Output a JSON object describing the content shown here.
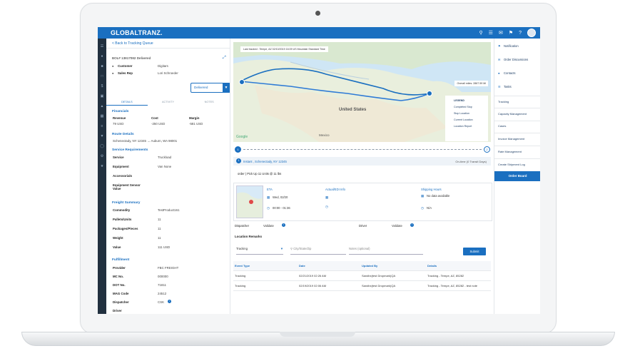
{
  "app": {
    "logo": "GLOBALTRANZ."
  },
  "detail": {
    "back_label": "< Back to Tracking Queue",
    "bol_status": "BOL# 13817082 Delivered",
    "customer_label": "Customer",
    "customer_value": "Digitars",
    "sales_rep_label": "Sales Rep",
    "sales_rep_value": "Lori Schroeder",
    "status_button": "Delivered",
    "tabs": [
      "DETAILS",
      "ACTIVITY",
      "NOTES"
    ],
    "financials_h": "Financials",
    "fin_headers": [
      "Revenue",
      "Cost",
      "Margin"
    ],
    "fin_values": [
      "79 USD",
      "-250 USD",
      "-581 USD"
    ],
    "route_h": "Route Details",
    "route_value": "Schenectady, NY 12345 → Auburn, WA 98001",
    "service_h": "Service Requirements",
    "service_rows": [
      {
        "k": "Service",
        "v": "Truckload"
      },
      {
        "k": "Equipment",
        "v": "Van None"
      },
      {
        "k": "Accessorials",
        "v": ""
      },
      {
        "k": "Equipment Sensor Value",
        "v": ""
      }
    ],
    "freight_h": "Freight Summary",
    "freight_rows": [
      {
        "k": "Commodity",
        "v": "TestProduct161"
      },
      {
        "k": "Pallets/Units",
        "v": "11"
      },
      {
        "k": "Packages/Pieces",
        "v": "11"
      },
      {
        "k": "Weight",
        "v": "11"
      },
      {
        "k": "Value",
        "v": "111 USD"
      }
    ],
    "fulfillment_h": "Fulfillment",
    "fulfillment_rows": [
      {
        "k": "Provider",
        "v": "FBC FREIGHT"
      },
      {
        "k": "MC No.",
        "v": "000000"
      },
      {
        "k": "DOT No.",
        "v": "71811"
      },
      {
        "k": "MAG Code",
        "v": "24512"
      },
      {
        "k": "Dispatcher",
        "v": "CSK"
      },
      {
        "k": "Driver",
        "v": ""
      }
    ]
  },
  "map": {
    "last_tracked": "Last tracked : Tempe, AZ 02/10/2019 16:09 US Mountain Standard Time",
    "overall_miles": "Overall miles: 2867.59 Mi",
    "country_label": "United States",
    "mexico_label": "Mexico",
    "google_label": "Google",
    "legend": [
      "LEGEND",
      "Completed Stop",
      "Stop Location",
      "Current Location",
      "Location Report"
    ]
  },
  "stop": {
    "title": "Instant , Schenectady, NY 12345",
    "on_time": "On-time (0 Transit Days)",
    "pickup_line": "order  |  Pick Up 11 Units @ 11 lbs",
    "eta_h": "ETA",
    "eta_date": "Wed, 02/20",
    "eta_time": "00:00 - 01:36",
    "actual_h": "Actual/EDI Info",
    "shipping_h": "Shipping Hours",
    "shipping_value": "No data available",
    "shipping_na": "N/A",
    "dispatcher_label": "Dispatcher",
    "dispatcher_value": "Validate",
    "driver_label": "Driver",
    "driver_value": "Validate"
  },
  "remarks": {
    "heading": "Location Remarks",
    "type_value": "Tracking",
    "city_placeholder": "City/State/Zip",
    "notes_placeholder": "Notes (optional)",
    "submit": "Submit"
  },
  "table": {
    "headers": [
      "Event Type",
      "Date",
      "Updated By",
      "Details"
    ],
    "rows": [
      [
        "Tracking",
        "02/21/2019 02:26 AM",
        "Sandbx(test Dropmark)QA",
        "Tracking - Tempe, AZ, 85282"
      ],
      [
        "Tracking",
        "02/19/2019 02:06 AM",
        "Sandbx(test Dropmark)QA",
        "Tracking - Tempe, AZ, 85282 - test note"
      ]
    ]
  },
  "right_panel": {
    "items": [
      "Notification",
      "Order Discussions",
      "Contacts",
      "Tasks"
    ],
    "links": [
      "Tracking",
      "Capacity Management",
      "Cases",
      "Invoice Management",
      "Rate Management",
      "Create Shipment Log"
    ],
    "order_board": "Order Board"
  }
}
